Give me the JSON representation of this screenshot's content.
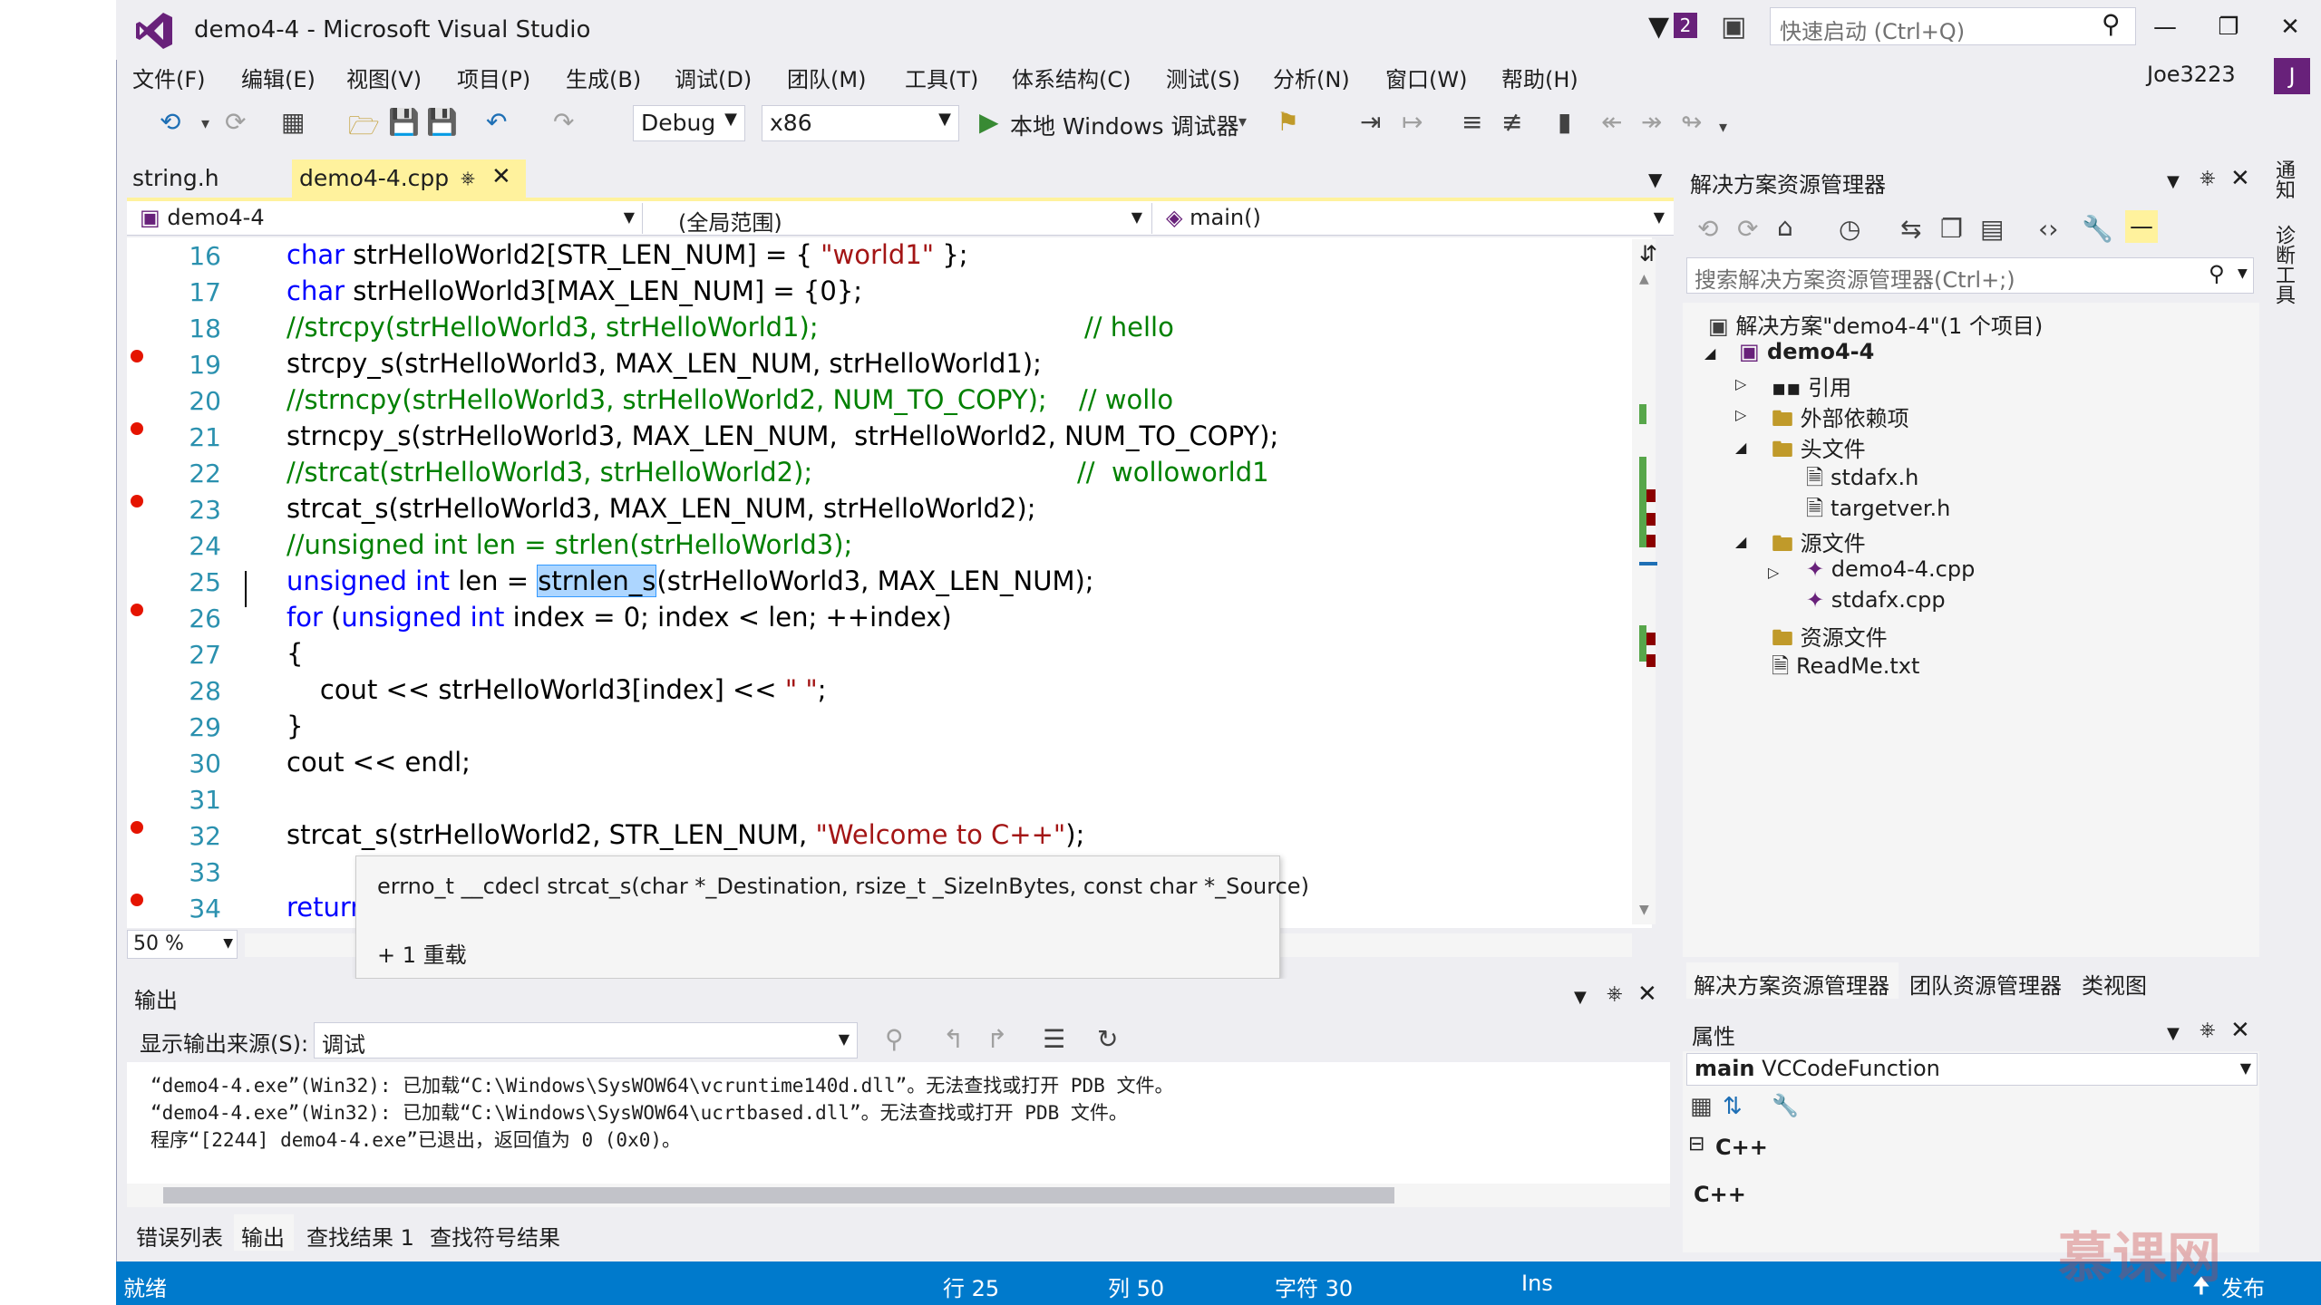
{
  "window": {
    "title": "demo4-4 - Microsoft Visual Studio",
    "notification_count": "2",
    "quick_launch_placeholder": "快速启动 (Ctrl+Q)",
    "user": "Joe3223",
    "avatar_letter": "J"
  },
  "menu": [
    "文件(F)",
    "编辑(E)",
    "视图(V)",
    "项目(P)",
    "生成(B)",
    "调试(D)",
    "团队(M)",
    "工具(T)",
    "体系结构(C)",
    "测试(S)",
    "分析(N)",
    "窗口(W)",
    "帮助(H)"
  ],
  "toolbar": {
    "config": "Debug",
    "platform": "x86",
    "run_label": "本地 Windows 调试器"
  },
  "tabs": {
    "inactive": "string.h",
    "active": "demo4-4.cpp"
  },
  "navbar": {
    "project": "demo4-4",
    "scope": "(全局范围)",
    "member": "main()"
  },
  "editor": {
    "line_numbers": [
      "16",
      "17",
      "18",
      "19",
      "20",
      "21",
      "22",
      "23",
      "24",
      "25",
      "26",
      "27",
      "28",
      "29",
      "30",
      "31",
      "32",
      "33",
      "34"
    ],
    "zoom": "50 %",
    "code": {
      "l16a": "char",
      "l16b": " strHelloWorld2[STR_LEN_NUM] = { ",
      "l16c": "\"world1\"",
      "l16d": " };",
      "l17a": "char",
      "l17b": " strHelloWorld3[MAX_LEN_NUM] = {0};",
      "l18": "//strcpy(strHelloWorld3, strHelloWorld1);",
      "l18c": "// hello",
      "l19": "strcpy_s(strHelloWorld3, MAX_LEN_NUM, strHelloWorld1);",
      "l20": "//strncpy(strHelloWorld3, strHelloWorld2, NUM_TO_COPY);",
      "l20c": "// wollo",
      "l21": "strncpy_s(strHelloWorld3, MAX_LEN_NUM,  strHelloWorld2, NUM_TO_COPY);",
      "l22": "//strcat(strHelloWorld3, strHelloWorld2);",
      "l22c": "//  wolloworld1",
      "l23": "strcat_s(strHelloWorld3, MAX_LEN_NUM, strHelloWorld2);",
      "l24": "//unsigned int len = strlen(strHelloWorld3);",
      "l25a": "unsigned int",
      "l25b": " len = ",
      "l25c": "strnlen_s",
      "l25d": "(strHelloWorld3, MAX_LEN_NUM);",
      "l26a": "for",
      "l26b": " (",
      "l26c": "unsigned int",
      "l26d": " index = 0; index < len; ++index)",
      "l27": "{",
      "l28a": "    cout << strHelloWorld3[index] << ",
      "l28b": "\" \"",
      "l28c": ";",
      "l29": "}",
      "l30": "cout << endl;",
      "l32a": "strcat_s(strHelloWorld2, STR_LEN_NUM, ",
      "l32b": "\"Welcome to C++\"",
      "l32c": ");",
      "l34": "return"
    }
  },
  "tooltip": {
    "signature": "errno_t __cdecl strcat_s(char *_Destination, rsize_t _SizeInBytes, const char *_Source)",
    "overloads": "+ 1 重载"
  },
  "output": {
    "title": "输出",
    "source_label": "显示输出来源(S):",
    "source_value": "调试",
    "lines": [
      "“demo4-4.exe”(Win32): 已加载“C:\\Windows\\SysWOW64\\vcruntime140d.dll”。无法查找或打开 PDB 文件。",
      "“demo4-4.exe”(Win32): 已加载“C:\\Windows\\SysWOW64\\ucrtbased.dll”。无法查找或打开 PDB 文件。",
      "程序“[2244] demo4-4.exe”已退出，返回值为 0 (0x0)。"
    ],
    "tabs": [
      "错误列表",
      "输出",
      "查找结果 1",
      "查找符号结果"
    ]
  },
  "status": {
    "ready": "就绪",
    "line": "行 25",
    "col": "列 50",
    "char": "字符 30",
    "mode": "Ins",
    "publish": "发布"
  },
  "solution_explorer": {
    "title": "解决方案资源管理器",
    "search_placeholder": "搜索解决方案资源管理器(Ctrl+;)",
    "solution": "解决方案\"demo4-4\"(1 个项目)",
    "project": "demo4-4",
    "references": "引用",
    "external_deps": "外部依赖项",
    "headers": "头文件",
    "header_files": [
      "stdafx.h",
      "targetver.h"
    ],
    "sources": "源文件",
    "source_files": [
      "demo4-4.cpp",
      "stdafx.cpp"
    ],
    "resources": "资源文件",
    "readme": "ReadMe.txt",
    "tabs": [
      "解决方案资源管理器",
      "团队资源管理器",
      "类视图"
    ]
  },
  "properties": {
    "title": "属性",
    "object": "main",
    "object_type": "VCCodeFunction",
    "category": "C++",
    "value": "C++"
  },
  "side_tabs": [
    "通知",
    "诊断工具"
  ],
  "watermark": "慕课网",
  "colors": {
    "accent": "#007acc",
    "brand": "#68217a",
    "breakpoint": "#e51400",
    "tab_active": "#fff29d"
  }
}
